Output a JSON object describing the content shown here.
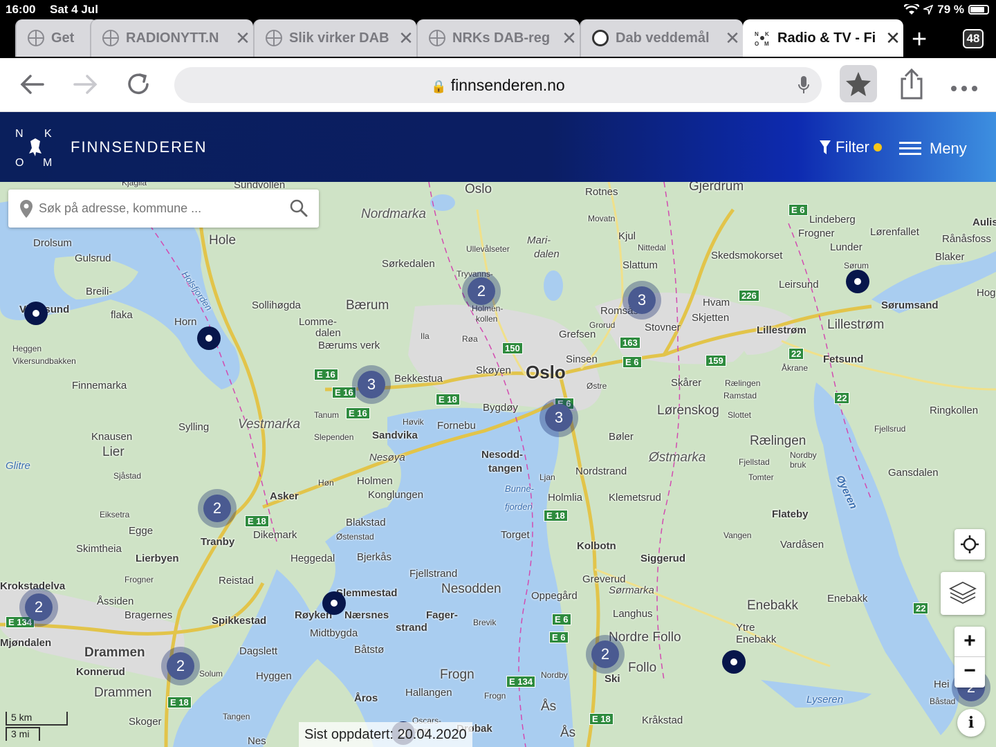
{
  "status": {
    "time": "16:00",
    "date": "Sat 4 Jul",
    "battery": "79 %"
  },
  "tabs": [
    {
      "label": "Get",
      "active": false
    },
    {
      "label": "RADIONYTT.N",
      "active": false
    },
    {
      "label": "Slik virker DAB",
      "active": false
    },
    {
      "label": "NRKs DAB-reg",
      "active": false
    },
    {
      "label": "Dab veddemål",
      "active": false
    },
    {
      "label": "Radio & TV - Fi",
      "active": true
    }
  ],
  "tab_count": "48",
  "browser": {
    "url": "finnsenderen.no"
  },
  "site": {
    "logo_letters": [
      "N",
      "K",
      "O",
      "M"
    ],
    "title": "FINNSENDEREN",
    "filter_label": "Filter",
    "menu_label": "Meny"
  },
  "search": {
    "placeholder": "Søk på adresse, kommune ..."
  },
  "map": {
    "clusters": [
      "2",
      "3",
      "3",
      "3",
      "2",
      "2",
      "2",
      "2",
      "2"
    ],
    "places": [
      "Oslo",
      "Nordmarka",
      "Rotnes",
      "Gjerdrum",
      "Movatn",
      "Kjul",
      "Nittedal",
      "Slattum",
      "Mari-",
      "dalen",
      "Ullevålseter",
      "Sørkedalen",
      "Tryvanns-",
      "Holmen-",
      "kollen",
      "Hole",
      "Drolsum",
      "Gulsrud",
      "Breili-",
      "flaka",
      "Holsfjorden",
      "Sollihøgda",
      "Bærum",
      "Lomme-",
      "dalen",
      "Bærums verk",
      "Ila",
      "Røa",
      "Vikersund",
      "Horn",
      "Heggen",
      "Vikersundbakken",
      "Finnemarka",
      "Bekkestua",
      "Skøyen",
      "Oslo",
      "Grefsen",
      "Sinsen",
      "Romsås",
      "Grorud",
      "Stovner",
      "Tanum",
      "Slependen",
      "Sandvika",
      "Høvik",
      "Fornebu",
      "Bygdøy",
      "Vestmarka",
      "Sylling",
      "Knausen",
      "Lier",
      "Glitre",
      "Sjåstad",
      "Nesøya",
      "Holmen",
      "Konglungen",
      "Høn",
      "Asker",
      "Nesodd-",
      "tangen",
      "Ljan",
      "Bunne-",
      "fjorden",
      "Holmlia",
      "Nordstrand",
      "Bøler",
      "Østre",
      "Lindeberg",
      "Frogner",
      "Lørenfallet",
      "Lunder",
      "Skedsmokorset",
      "Leirsund",
      "Sørum",
      "Sørumsand",
      "Blaker",
      "Rånåsfoss",
      "Aulis",
      "Hog",
      "Hvam",
      "Skjetten",
      "Lillestrøm",
      "Lillestrøm",
      "Åkrane",
      "Fetsund",
      "Skårer",
      "Lørenskog",
      "Ramstad",
      "Rælingen",
      "Slottet",
      "Fjellsrud",
      "Ringkollen",
      "Rælingen",
      "Fjellstad",
      "Tomter",
      "Nordby bruk",
      "Øyeren",
      "Gansdalen",
      "Østmarka",
      "Klemetsrud",
      "Flateby",
      "Vangen",
      "Vardåsen",
      "Eiksetra",
      "Egge",
      "Skimtheia",
      "Lierbyen",
      "Tranby",
      "Dikemark",
      "Heggedal",
      "Bjerkås",
      "Blakstad",
      "Østenstad",
      "Torget",
      "Kolbotn",
      "Siggerud",
      "Nesodden",
      "Fjellstrand",
      "Greverud",
      "Sørmarka",
      "Oppegård",
      "Enebakk",
      "Enebakk",
      "Ytre Enebakk",
      "Langhus",
      "Nordre Follo",
      "Follo",
      "Ski",
      "Nordby",
      "Frogn",
      "Frogn",
      "Fager-",
      "strand",
      "Brevik",
      "Hallangen",
      "Åros",
      "Båtstø",
      "Midtbygda",
      "Røyken",
      "Nærsnes",
      "Slemmestad",
      "Dagslett",
      "Hyggen",
      "Spikkestad",
      "Reistad",
      "Frogner",
      "Åssiden",
      "Bragernes",
      "Drammen",
      "Konnerud",
      "Drammen",
      "Solum",
      "Tangen",
      "Skoger",
      "Mjøndalen",
      "Lyseren",
      "Hei",
      "Båstad",
      "Kråkstad",
      "Ås",
      "Ås",
      "Oscars-",
      "borg",
      "Nes",
      "Drøbak",
      "Krokstadelva",
      "Sundvollen",
      "Kjaglia"
    ],
    "roads": [
      "E 6",
      "226",
      "150",
      "163",
      "E 6",
      "159",
      "22",
      "22",
      "E 16",
      "E 16",
      "E 16",
      "E 18",
      "E 6",
      "E 18",
      "E 18",
      "E 6",
      "E 6",
      "E 134",
      "E 18",
      "22",
      "E 134",
      "E 18"
    ],
    "updated_label": "Sist oppdatert:",
    "updated_date": "20.04.2020",
    "scale_km": "5 km",
    "scale_mi": "3 mi",
    "zoom_in": "+",
    "zoom_out": "−",
    "info": "i"
  },
  "colors": {
    "header_start": "#0a1f5c",
    "header_end": "#3d8fe0",
    "filter_dot": "#f5c518",
    "marker": "#07164b",
    "cluster": "#4a5a91"
  }
}
